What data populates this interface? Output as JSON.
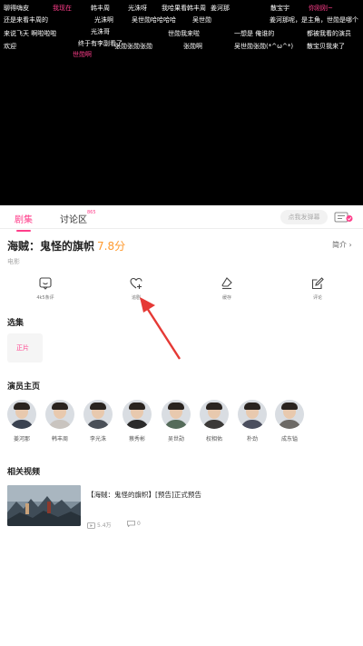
{
  "danmaku": [
    {
      "text": "聊得嗨皮",
      "color": "#ffffff"
    },
    {
      "text": "我现在",
      "color": "#ff3d8a"
    },
    {
      "text": "韩丰周",
      "color": "#ffffff"
    },
    {
      "text": "光洙呀",
      "color": "#ffffff"
    },
    {
      "text": "我哈果看韩丰周",
      "color": "#ffffff"
    },
    {
      "text": "姜河那",
      "color": "#ffffff"
    },
    {
      "text": "散宝宇",
      "color": "#ffffff"
    },
    {
      "text": "你刚刚~",
      "color": "#ff3d8a"
    },
    {
      "text": "还是来看丰周的",
      "color": "#ffffff"
    },
    {
      "text": "光洙啊",
      "color": "#ffffff"
    },
    {
      "text": "吴世勋哈哈哈哈",
      "color": "#ffffff"
    },
    {
      "text": "吴世勋",
      "color": "#ffffff"
    },
    {
      "text": "姜河那呢，是主角，世勋是哪个",
      "color": "#ffffff"
    },
    {
      "text": "光洙哥",
      "color": "#ffffff"
    },
    {
      "text": "来说飞天 啊啦啦啦",
      "color": "#ffffff"
    },
    {
      "text": "终于有李副看了",
      "color": "#ffffff"
    },
    {
      "text": "世勋我来啦",
      "color": "#ffffff"
    },
    {
      "text": "一想是 俺谁的",
      "color": "#ffffff"
    },
    {
      "text": "都被我看的演员",
      "color": "#ffffff"
    },
    {
      "text": "欢迎",
      "color": "#ffffff"
    },
    {
      "text": "世勋啊",
      "color": "#ff3d8a"
    },
    {
      "text": "张勋张勋张勋",
      "color": "#ffffff"
    },
    {
      "text": "张勋啊",
      "color": "#ffffff"
    },
    {
      "text": "吴世勋张勋(*^ω^*)",
      "color": "#ffffff"
    },
    {
      "text": "散宝贝我来了",
      "color": "#ffffff"
    }
  ],
  "tabs": {
    "episodes": "剧集",
    "discussion": "讨论区",
    "discussion_count": "865"
  },
  "danmaku_input": {
    "placeholder": "点我发弹幕"
  },
  "title": {
    "name": "海贼：鬼怪的旗帜",
    "score": "7.8分",
    "intro": "简介",
    "category": "电影"
  },
  "actions": [
    {
      "icon": "smile-rating-icon",
      "label": "4k5条评"
    },
    {
      "icon": "heart-plus-icon",
      "label": "追剧"
    },
    {
      "icon": "eraser-cache-icon",
      "label": "缓存"
    },
    {
      "icon": "edit-review-icon",
      "label": "评论"
    }
  ],
  "episodes": {
    "header": "选集",
    "items": [
      "正片"
    ]
  },
  "cast": {
    "header": "演员主页",
    "members": [
      {
        "name": "姜河那",
        "shirt": "#3a4250"
      },
      {
        "name": "韩丰周",
        "shirt": "#c9c4bf"
      },
      {
        "name": "李光洙",
        "shirt": "#4a5058"
      },
      {
        "name": "蔡秀彬",
        "shirt": "#2b2b2b"
      },
      {
        "name": "吴世勋",
        "shirt": "#556b5a"
      },
      {
        "name": "权相佑",
        "shirt": "#3c3a38"
      },
      {
        "name": "朴劲",
        "shirt": "#4b4f5e"
      },
      {
        "name": "成东镒",
        "shirt": "#6d6a66"
      }
    ]
  },
  "related": {
    "header": "相关视频",
    "videos": [
      {
        "title": "【海贼：鬼怪的旗帜】[预告]正式预告",
        "plays": "5.4万",
        "comments": "0"
      }
    ]
  },
  "colors": {
    "accent": "#ff3d8a",
    "score": "#ff9a2e",
    "arrow": "#e53935"
  }
}
